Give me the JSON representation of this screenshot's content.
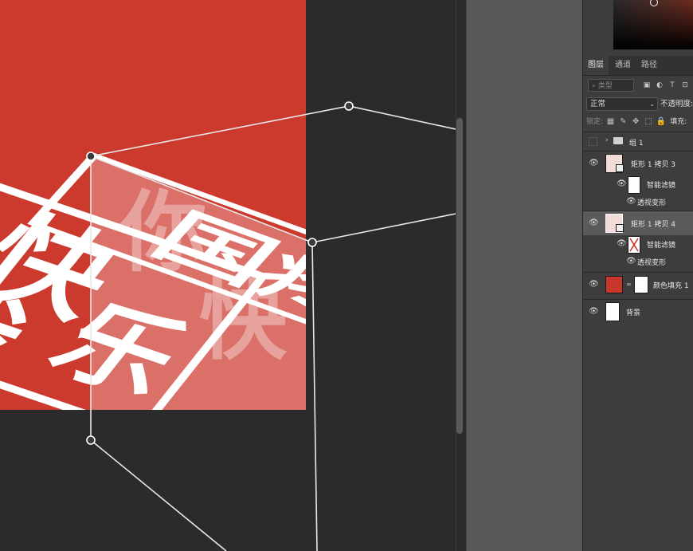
{
  "canvas": {
    "artwork_glyphs": [
      "国",
      "疼",
      "我",
      "快",
      "乐",
      "你"
    ],
    "colors": {
      "artwork_red": "#cc3a2e",
      "transform_line": "#e8e8e8",
      "canvas_bg": "#2b2b2b"
    }
  },
  "panel": {
    "tabs": [
      "图层",
      "通道",
      "路径"
    ],
    "active_tab": "图层",
    "filter_placeholder": "类型",
    "filter_icons": [
      "image-filter-icon",
      "adjustment-filter-icon",
      "type-filter-icon",
      "shape-filter-icon"
    ],
    "filter_glyphs": [
      "▣",
      "◐",
      "T",
      "⊡"
    ],
    "blend_mode": "正常",
    "opacity_label": "不透明度:",
    "lock_label": "锁定:",
    "lock_glyphs": [
      "▦",
      "✎",
      "✥",
      "⬚",
      "🔒"
    ],
    "fill_label": "填充:",
    "layers": [
      {
        "name": "组 1",
        "type": "group",
        "visible": false
      },
      {
        "name": "矩形 1 拷贝 3",
        "type": "smart-object",
        "visible": true
      },
      {
        "name": "智能滤镜",
        "type": "smart-filter",
        "visible": true
      },
      {
        "name": "透视变形",
        "type": "filter-effect",
        "visible": true
      },
      {
        "name": "矩形 1 拷贝 4",
        "type": "smart-object",
        "visible": true,
        "selected": true
      },
      {
        "name": "智能滤镜",
        "type": "smart-filter",
        "visible": true
      },
      {
        "name": "透视变形",
        "type": "filter-effect",
        "visible": true
      },
      {
        "name": "颜色填充 1",
        "type": "fill",
        "visible": true,
        "color": "#c9372c"
      },
      {
        "name": "背景",
        "type": "background",
        "visible": true
      }
    ]
  }
}
